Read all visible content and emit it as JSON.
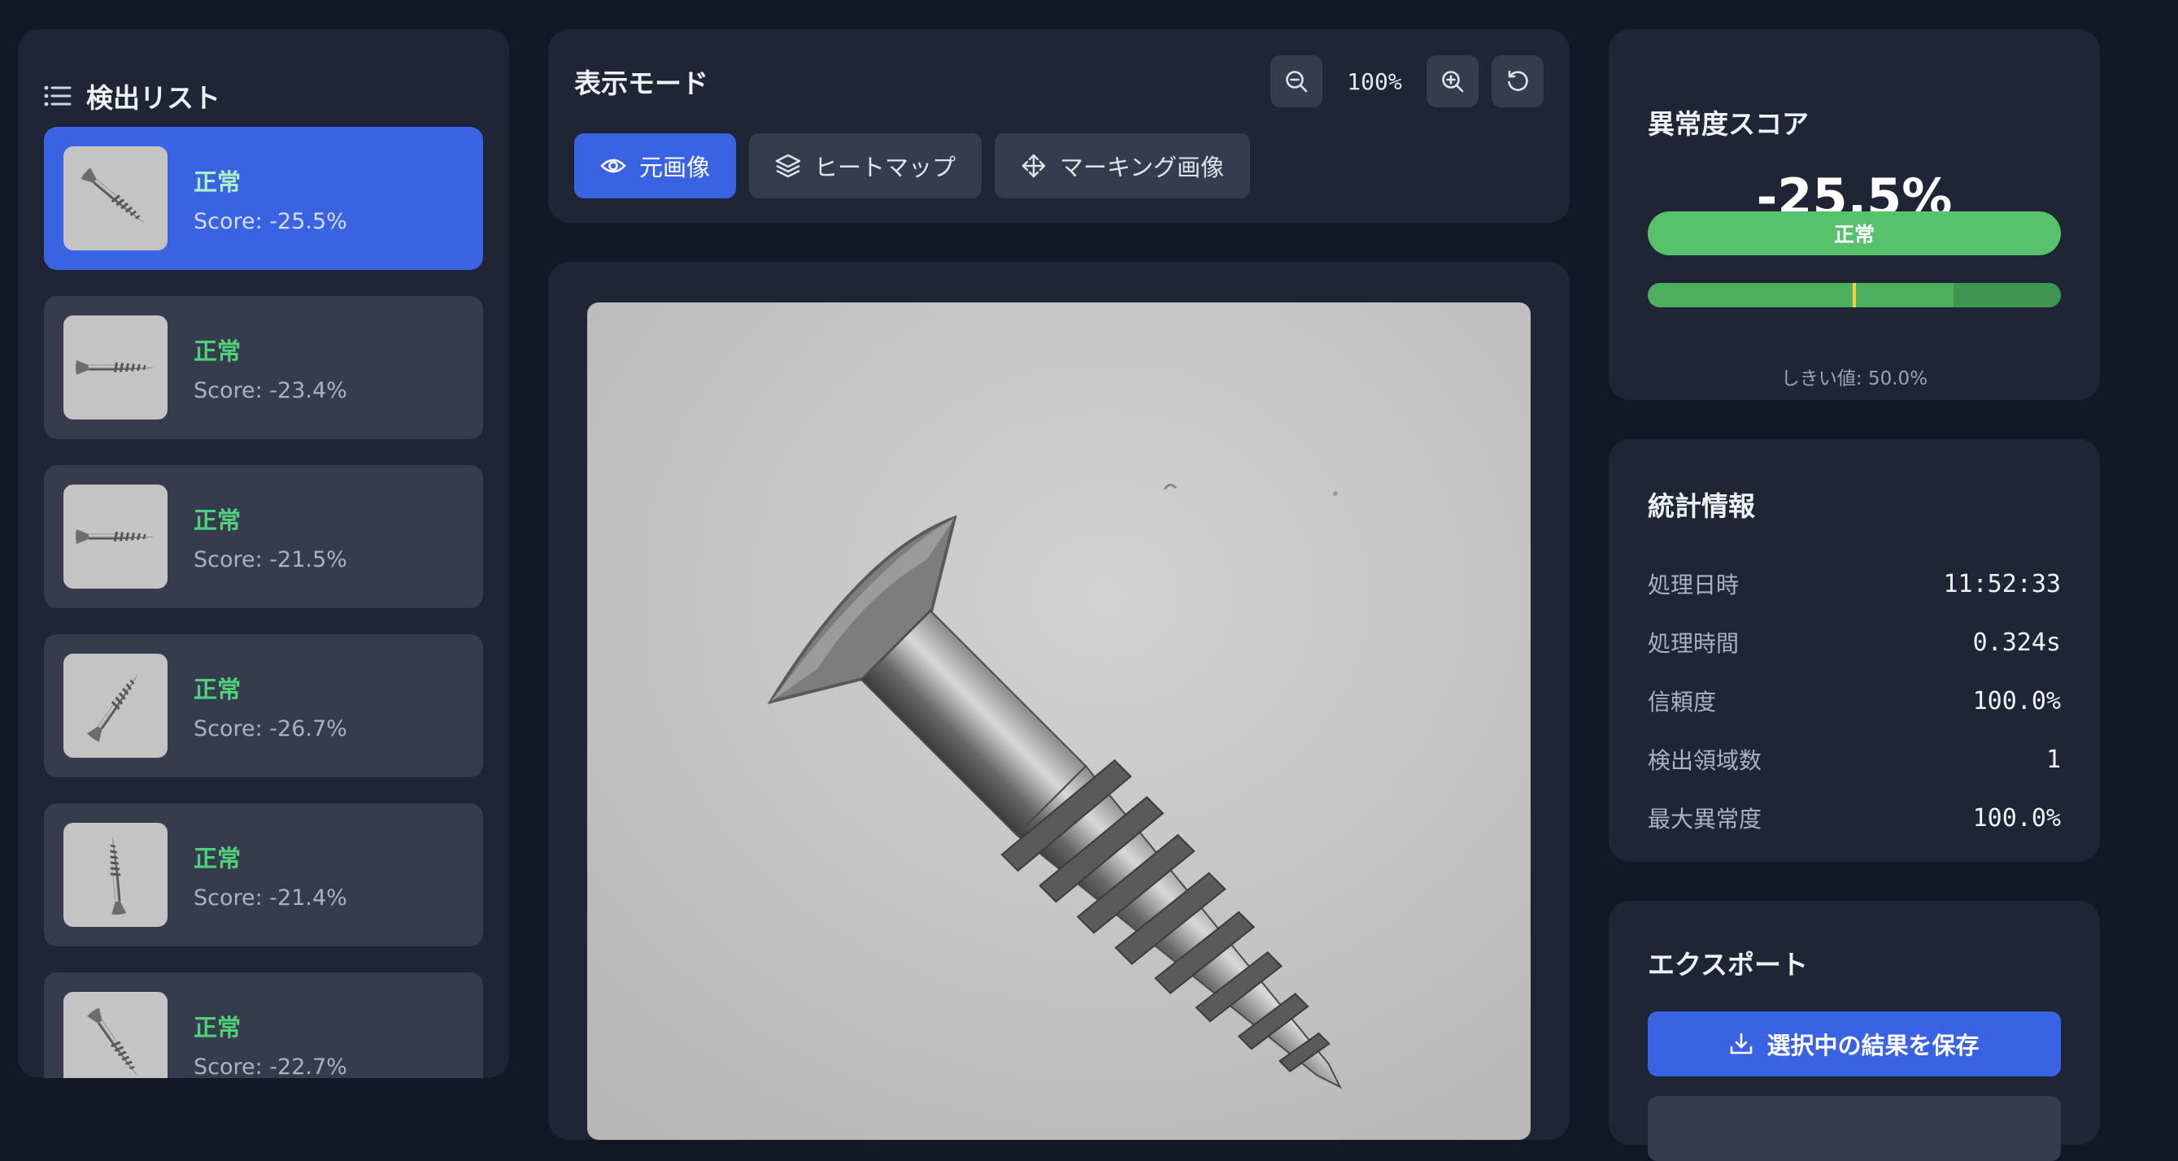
{
  "list": {
    "title": "検出リスト",
    "items": [
      {
        "status": "正常",
        "score": "Score: -25.5%",
        "selected": true
      },
      {
        "status": "正常",
        "score": "Score: -23.4%"
      },
      {
        "status": "正常",
        "score": "Score: -21.5%"
      },
      {
        "status": "正常",
        "score": "Score: -26.7%"
      },
      {
        "status": "正常",
        "score": "Score: -21.4%"
      },
      {
        "status": "正常",
        "score": "Score: -22.7%"
      }
    ]
  },
  "mode": {
    "title": "表示モード",
    "zoom": "100%",
    "tabs": [
      {
        "label": "元画像",
        "icon": "eye-icon",
        "active": true
      },
      {
        "label": "ヒートマップ",
        "icon": "layers-icon"
      },
      {
        "label": "マーキング画像",
        "icon": "move-icon"
      }
    ]
  },
  "score": {
    "title": "異常度スコア",
    "value": "-25.5%",
    "status": "正常",
    "bar_marker_fraction": 0.5,
    "bar_green_fraction": 0.74,
    "threshold": "しきい値: 50.0%"
  },
  "stats": {
    "title": "統計情報",
    "rows": [
      {
        "label": "処理日時",
        "value": "11:52:33"
      },
      {
        "label": "処理時間",
        "value": "0.324s"
      },
      {
        "label": "信頼度",
        "value": "100.0%"
      },
      {
        "label": "検出領域数",
        "value": "1"
      },
      {
        "label": "最大異常度",
        "value": "100.0%"
      }
    ]
  },
  "export": {
    "title": "エクスポート",
    "save_label": "選択中の結果を保存"
  },
  "colors": {
    "accent": "#3a63e4",
    "normal": "#4fd17c",
    "panel": "#1f2534",
    "background": "#121826"
  }
}
